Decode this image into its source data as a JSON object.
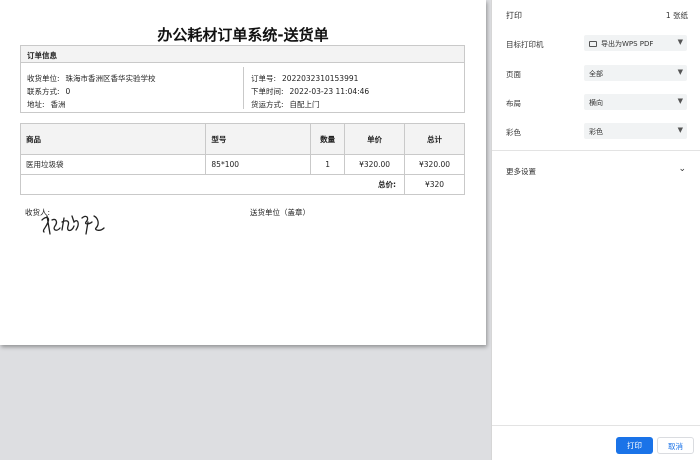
{
  "document": {
    "title": "办公耗材订单系统-送货单",
    "info_header": "订单信息",
    "left": [
      {
        "label": "收货单位:",
        "value": "珠海市香洲区香华实验学校"
      },
      {
        "label": "联系方式:",
        "value": "0"
      },
      {
        "label": "地址:",
        "value": "香洲"
      }
    ],
    "right": [
      {
        "label": "订单号:",
        "value": "2022032310153991"
      },
      {
        "label": "下单时间:",
        "value": "2022-03-23 11:04:46"
      },
      {
        "label": "货运方式:",
        "value": "自配上门"
      }
    ],
    "table": {
      "headers": [
        "商品",
        "型号",
        "数量",
        "单价",
        "总计"
      ],
      "rows": [
        [
          "医用垃圾袋",
          "85*100",
          "1",
          "¥320.00",
          "¥320.00"
        ]
      ],
      "total_label": "总价:",
      "total_value": "¥320"
    },
    "receiver_label": "收货人:",
    "receiver_signature": "郭继东",
    "sender_label": "送货单位（盖章）"
  },
  "print_panel": {
    "title": "打印",
    "sheet_count": "1 张纸",
    "destination_label": "目标打印机",
    "destination_value": "导出为WPS PDF",
    "destination_icon": "printer-icon",
    "pages_label": "页面",
    "pages_value": "全部",
    "layout_label": "布局",
    "layout_value": "横向",
    "color_label": "彩色",
    "color_value": "彩色",
    "more_settings": "更多设置",
    "print_button": "打印",
    "cancel_button": "取消",
    "accent_color": "#1a73e8"
  }
}
